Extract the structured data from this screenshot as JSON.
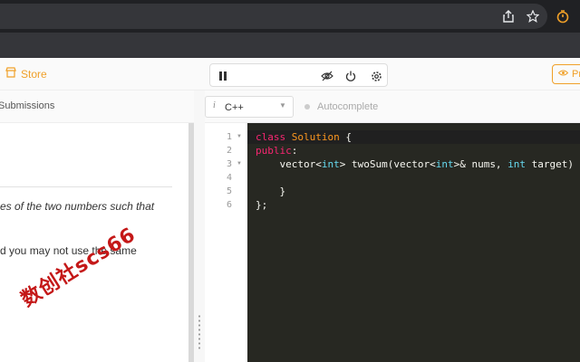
{
  "header": {
    "store_label": "Store",
    "premium_label": "Pr"
  },
  "left_panel": {
    "tab_label": "Submissions",
    "description_line1": "es of the two numbers such that",
    "description_line2": "d you may not use the same"
  },
  "editor": {
    "language": "C++",
    "language_info": "i",
    "autocomplete_label": "Autocomplete",
    "line_numbers": [
      "1",
      "2",
      "3",
      "4",
      "5",
      "6"
    ],
    "code": {
      "l1_kw": "class",
      "l1_name": "Solution",
      "l1_rest": " {",
      "l2_kw": "public",
      "l2_rest": ":",
      "l3_a": "    vector<",
      "l3_t1": "int",
      "l3_b": "> twoSum(vector<",
      "l3_t2": "int",
      "l3_c": ">& nums, ",
      "l3_t3": "int",
      "l3_d": " target) {",
      "l5": "    }",
      "l6": "};"
    }
  },
  "watermark": "数创社scs66",
  "colors": {
    "accent": "#f0a028",
    "editor_bg": "#272822",
    "keyword": "#f92672",
    "class_name": "#fd971f",
    "type": "#66d9ef",
    "watermark": "#c41818"
  },
  "icons": {
    "share": "share-icon",
    "bookmark": "star-icon",
    "extension": "timer-icon",
    "store": "store-icon",
    "pause": "pause-icon",
    "hide": "eye-off-icon",
    "reset": "power-icon",
    "settings": "gear-icon",
    "premium": "eye-icon"
  }
}
